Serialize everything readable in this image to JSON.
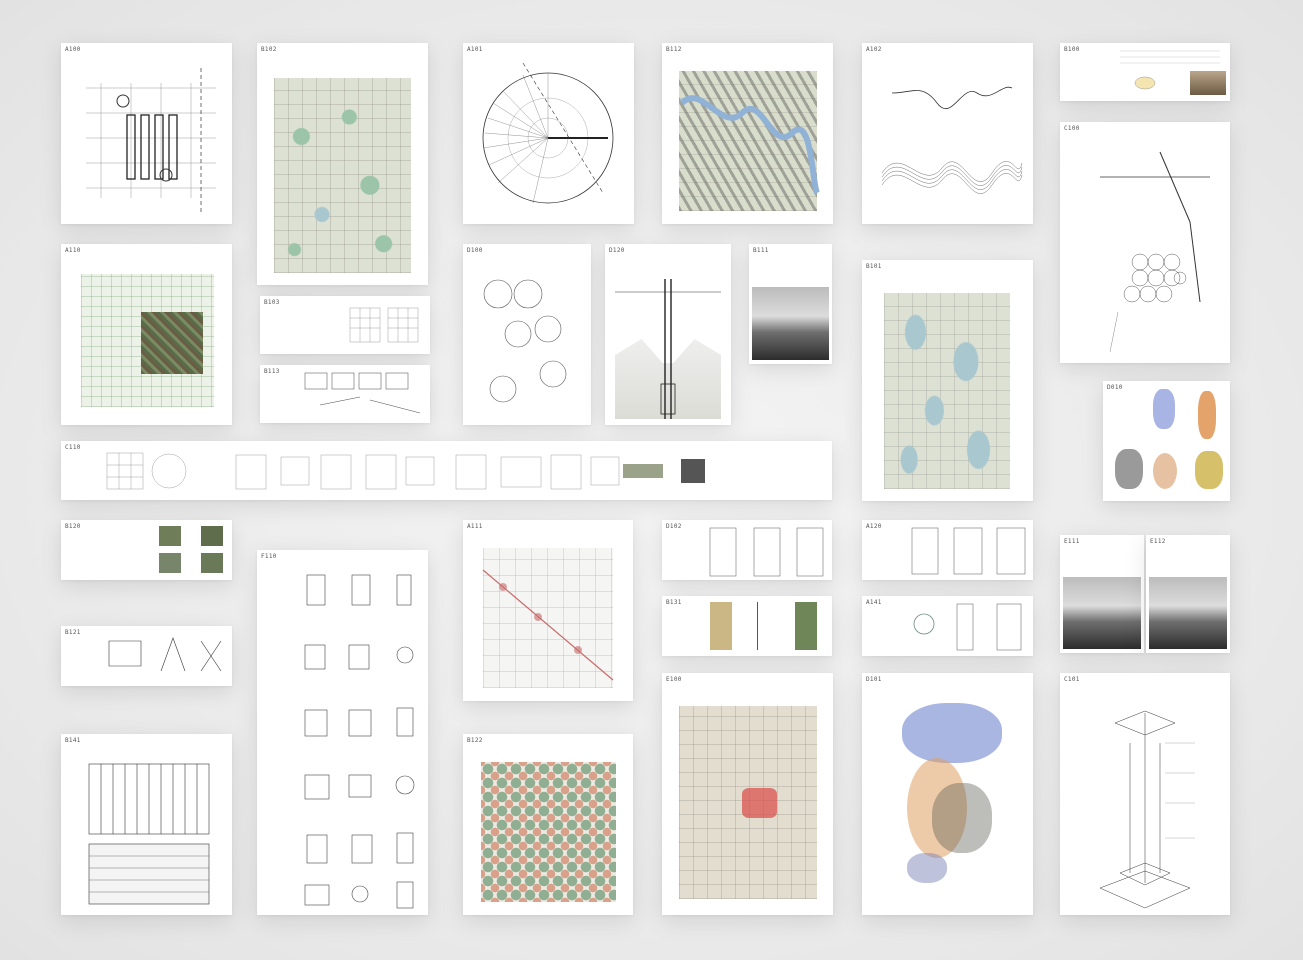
{
  "sheets": {
    "a100": "A100",
    "b102": "B102",
    "a101": "A101",
    "b112": "B112",
    "a102": "A102",
    "b100": "B100",
    "c100": "C100",
    "a110": "A110",
    "b103": "B103",
    "b113": "B113",
    "d100": "D100",
    "d120": "D120",
    "b111": "B111",
    "b101": "B101",
    "d010": "D010",
    "c110": "C110",
    "b120": "B120",
    "b121": "B121",
    "f110": "F110",
    "a111": "A111",
    "b122": "B122",
    "d102": "D102",
    "b131": "B131",
    "b141": "B141",
    "e111": "E111",
    "e112": "E112",
    "a120": "A120",
    "a141": "A141",
    "e100": "E100",
    "d101": "D101",
    "c101": "C101"
  },
  "colors": {
    "background": "#e9e9e9",
    "sheet": "#ffffff",
    "map_green": "#9cc4a8",
    "map_blue": "#a9c7cf",
    "town_red": "#d9534f",
    "cloud_blue": "#8c9ed8",
    "cloud_orange": "#e0a060"
  },
  "icons": [
    "drawing-sheet",
    "map",
    "photograph",
    "diagram"
  ]
}
